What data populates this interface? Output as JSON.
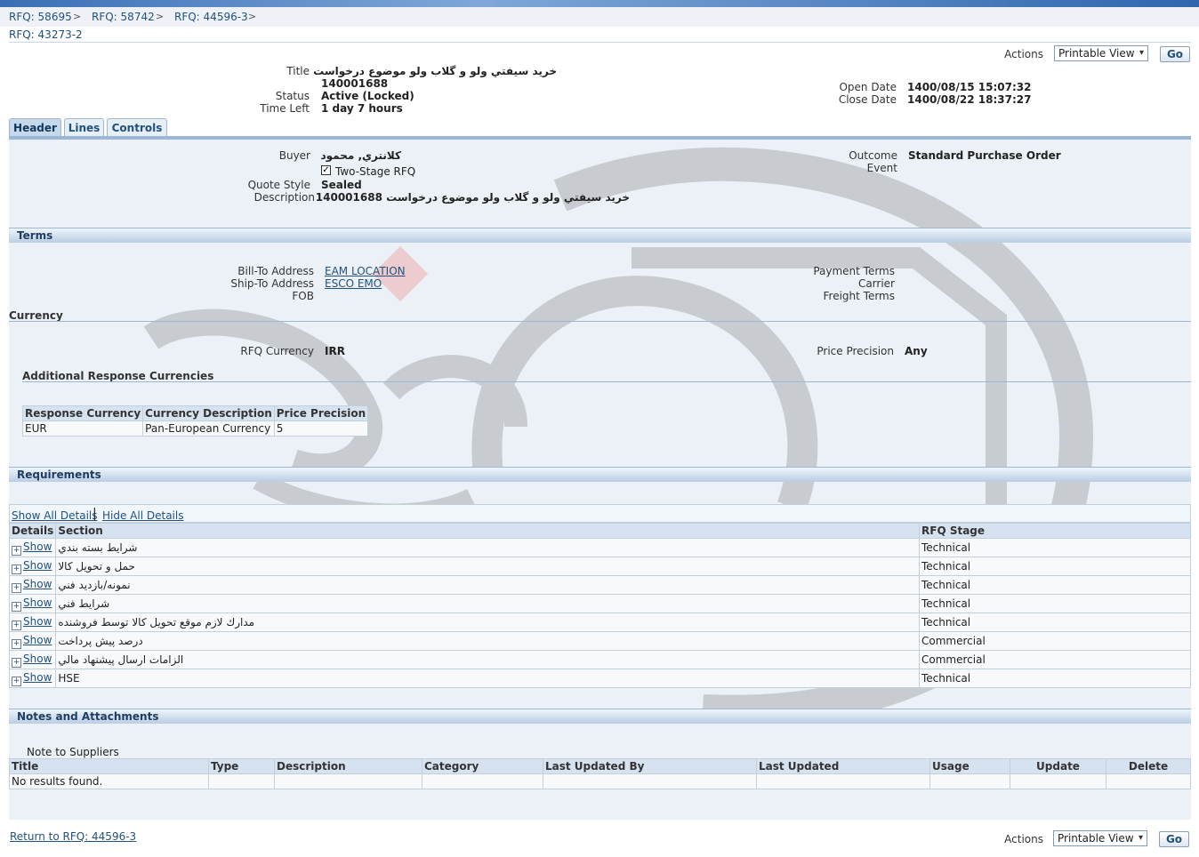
{
  "breadcrumbs": [
    "RFQ: 58695",
    "RFQ: 58742",
    "RFQ: 44596-3"
  ],
  "breadcrumb_sep": ">",
  "page_title": "RFQ: 43273-2",
  "actions": {
    "label": "Actions",
    "select_value": "Printable View",
    "go": "Go"
  },
  "summary": {
    "title_label": "Title",
    "title_value": "خريد سيفتي ولو و گلاب ولو موضوع درخواست",
    "title_value2": "140001688",
    "status_label": "Status",
    "status_value": "Active (Locked)",
    "time_left_label": "Time Left",
    "time_left_value": "1 day 7 hours",
    "open_date_label": "Open Date",
    "open_date_value": "1400/08/15 15:07:32",
    "close_date_label": "Close Date",
    "close_date_value": "1400/08/22 18:37:27"
  },
  "tabs": [
    "Header",
    "Lines",
    "Controls"
  ],
  "header": {
    "buyer_label": "Buyer",
    "buyer_value": "كلانتري, محمود",
    "two_stage_label": "Two-Stage RFQ",
    "quote_style_label": "Quote Style",
    "quote_style_value": "Sealed",
    "description_label": "Description",
    "description_value": "خريد سيفتي ولو و گلاب ولو موضوع درخواست 140001688",
    "outcome_label": "Outcome",
    "outcome_value": "Standard Purchase Order",
    "event_label": "Event"
  },
  "terms": {
    "heading": "Terms",
    "bill_to_label": "Bill-To Address",
    "bill_to_value": "EAM LOCATION",
    "ship_to_label": "Ship-To Address",
    "ship_to_value": "ESCO EMO",
    "fob_label": "FOB",
    "payment_terms_label": "Payment Terms",
    "carrier_label": "Carrier",
    "freight_terms_label": "Freight Terms"
  },
  "currency": {
    "heading": "Currency",
    "rfq_currency_label": "RFQ Currency",
    "rfq_currency_value": "IRR",
    "price_precision_label": "Price Precision",
    "price_precision_value": "Any",
    "additional_heading": "Additional Response Currencies",
    "columns": [
      "Response Currency",
      "Currency Description",
      "Price Precision"
    ],
    "rows": [
      [
        "EUR",
        "Pan-European Currency",
        "5"
      ]
    ]
  },
  "requirements": {
    "heading": "Requirements",
    "show_all": "Show All Details",
    "hide_all": "Hide All Details",
    "col_details": "Details",
    "col_section": "Section",
    "col_stage": "RFQ Stage",
    "show_label": "Show",
    "rows": [
      {
        "section": "شرايط بسته بندي",
        "stage": "Technical"
      },
      {
        "section": "حمل و تحويل كالا",
        "stage": "Technical"
      },
      {
        "section": "نمونه/بازديد فني",
        "stage": "Technical"
      },
      {
        "section": "شرايط فني",
        "stage": "Technical"
      },
      {
        "section": "مدارك لازم موقع تحويل كالا توسط فروشنده",
        "stage": "Technical"
      },
      {
        "section": "درصد پيش پرداخت",
        "stage": "Commercial"
      },
      {
        "section": "الزامات ارسال پيشنهاد مالي",
        "stage": "Commercial"
      },
      {
        "section": "HSE",
        "stage": "Technical"
      }
    ]
  },
  "notes": {
    "heading": "Notes and Attachments",
    "note_to_suppliers": "Note to Suppliers",
    "columns": [
      "Title",
      "Type",
      "Description",
      "Category",
      "Last Updated By",
      "Last Updated",
      "Usage",
      "Update",
      "Delete"
    ],
    "empty_text": "No results found."
  },
  "footer": {
    "return_link": "Return to RFQ: 44596-3"
  },
  "colors": {
    "accent": "#21527f",
    "section_bar": "#b9cde4",
    "panel": "#ebf1f7"
  }
}
